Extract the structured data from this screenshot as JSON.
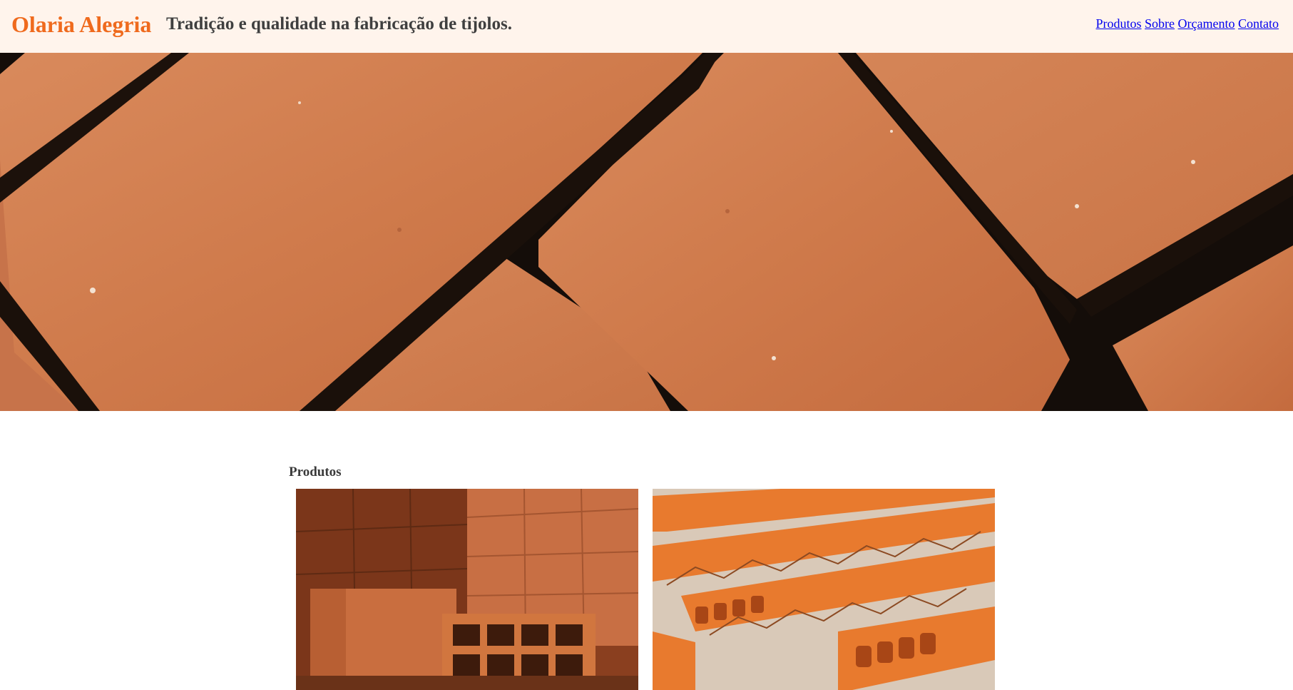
{
  "header": {
    "brand": "Olaria Alegria",
    "tagline": "Tradição e qualidade na fabricação de tijolos.",
    "nav": [
      {
        "label": "Produtos"
      },
      {
        "label": "Sobre"
      },
      {
        "label": "Orçamento"
      },
      {
        "label": "Contato"
      }
    ]
  },
  "products": {
    "title": "Produtos"
  },
  "colors": {
    "brand": "#ef6a1d",
    "header_bg": "#fff4ec",
    "link": "#0000ee",
    "brick": "#d07a4d"
  }
}
